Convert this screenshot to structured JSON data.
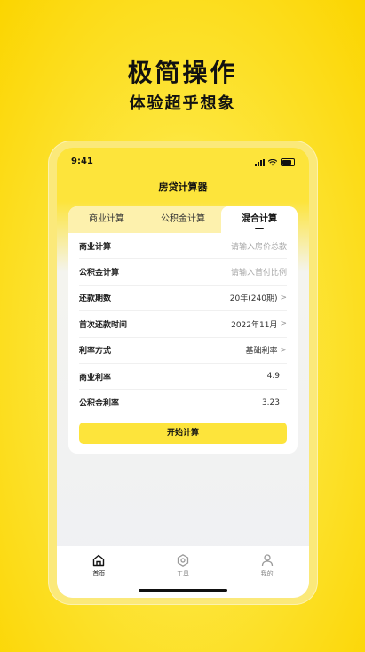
{
  "promo": {
    "headline": "极简操作",
    "subhead": "体验超乎想象"
  },
  "status_bar": {
    "time": "9:41"
  },
  "app": {
    "title": "房贷计算器"
  },
  "tabs": [
    {
      "label": "商业计算",
      "active": false
    },
    {
      "label": "公积金计算",
      "active": false
    },
    {
      "label": "混合计算",
      "active": true
    }
  ],
  "form": {
    "rows": [
      {
        "label": "商业计算",
        "placeholder": "请输入房价总款"
      },
      {
        "label": "公积金计算",
        "placeholder": "请输入首付比例"
      },
      {
        "label": "还款期数",
        "value": "20年(240期)"
      },
      {
        "label": "首次还款时间",
        "value": "2022年11月"
      },
      {
        "label": "利率方式",
        "value": "基础利率"
      },
      {
        "label": "商业利率",
        "value": "4.9"
      },
      {
        "label": "公积金利率",
        "value": "3.23"
      }
    ],
    "chevron": ">",
    "start_button": "开始计算"
  },
  "tabbar": {
    "items": [
      {
        "label": "首页",
        "icon": "home-icon",
        "active": true
      },
      {
        "label": "工具",
        "icon": "tools-icon",
        "active": false
      },
      {
        "label": "我的",
        "icon": "profile-icon",
        "active": false
      }
    ]
  },
  "colors": {
    "accent": "#fde43b",
    "background": "#fbd500",
    "text": "#111111"
  }
}
